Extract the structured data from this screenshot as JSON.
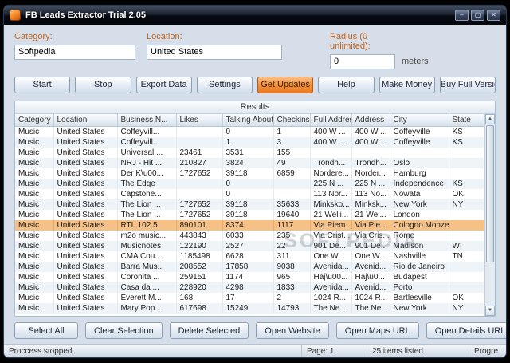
{
  "window": {
    "title": "FB Leads Extractor Trial 2.05",
    "minimize": "–",
    "maximize": "▢",
    "close": "✕"
  },
  "form": {
    "category_label": "Category:",
    "category_value": "Softpedia",
    "location_label": "Location:",
    "location_value": "United States",
    "radius_label": "Radius (0 unlimited):",
    "radius_value": "0",
    "radius_unit": "meters"
  },
  "toolbar": {
    "buttons": [
      "Start",
      "Stop",
      "Export Data",
      "Settings",
      "Get Updates",
      "Help",
      "Make Money",
      "Buy Full Version"
    ]
  },
  "results": {
    "title": "Results",
    "columns": [
      "Category",
      "Location",
      "Business N...",
      "Likes",
      "Talking About",
      "Checkins",
      "Full Address",
      "Address",
      "City",
      "State"
    ],
    "selected_index": 9,
    "rows": [
      [
        "Music",
        "United States",
        "Coffeyvill...",
        "",
        "0",
        "1",
        "400 W ...",
        "400 W ...",
        "Coffeyville",
        "KS"
      ],
      [
        "Music",
        "United States",
        "Coffeyvill...",
        "",
        "1",
        "3",
        "400 W ...",
        "400 W ...",
        "Coffeyville",
        "KS"
      ],
      [
        "Music",
        "United States",
        "Universal ...",
        "23461",
        "3531",
        "155",
        "",
        "",
        "",
        ""
      ],
      [
        "Music",
        "United States",
        "NRJ - Hit ...",
        "210827",
        "3824",
        "49",
        "Trondh...",
        "Trondh...",
        "Oslo",
        ""
      ],
      [
        "Music",
        "United States",
        "Der K\\u00...",
        "1727652",
        "39118",
        "6859",
        "Nordere...",
        "Norder...",
        "Hamburg",
        ""
      ],
      [
        "Music",
        "United States",
        "The Edge",
        "",
        "0",
        "",
        "225 N ...",
        "225 N ...",
        "Independence",
        "KS"
      ],
      [
        "Music",
        "United States",
        "Capstone...",
        "",
        "0",
        "",
        "113 Nor...",
        "113 No...",
        "Nowata",
        "OK"
      ],
      [
        "Music",
        "United States",
        "The Lion ...",
        "1727652",
        "39118",
        "35633",
        "Minksko...",
        "Minksk...",
        "New York",
        "NY"
      ],
      [
        "Music",
        "United States",
        "The Lion ...",
        "1727652",
        "39118",
        "19640",
        "21 Welli...",
        "21 Wel...",
        "London",
        ""
      ],
      [
        "Music",
        "United States",
        "RTL 102.5",
        "890101",
        "8374",
        "1117",
        "Via Piem...",
        "Via Pie...",
        "Cologno Monzese",
        ""
      ],
      [
        "Music",
        "United States",
        "m2o music...",
        "443843",
        "6033",
        "235",
        "Via Crist...",
        "Via Cris...",
        "Rome",
        ""
      ],
      [
        "Music",
        "United States",
        "Musicnotes",
        "122190",
        "2527",
        "22",
        "901 De...",
        "901 De...",
        "Madison",
        "WI"
      ],
      [
        "Music",
        "United States",
        "CMA Cou...",
        "1185498",
        "6628",
        "311",
        "One W...",
        "One W...",
        "Nashville",
        "TN"
      ],
      [
        "Music",
        "United States",
        "Barra Mus...",
        "208552",
        "17858",
        "9038",
        "Avenida...",
        "Avenid...",
        "Rio de Janeiro",
        ""
      ],
      [
        "Music",
        "United States",
        "Coronita ...",
        "259151",
        "1174",
        "965",
        "Haj\\u00...",
        "Haj\\u0...",
        "Budapest",
        ""
      ],
      [
        "Music",
        "United States",
        "Casa da ...",
        "228920",
        "4298",
        "1833",
        "Avenida...",
        "Avenid...",
        "Porto",
        ""
      ],
      [
        "Music",
        "United States",
        "Everett M...",
        "168",
        "17",
        "2",
        "1024 R...",
        "1024 R...",
        "Bartlesville",
        "OK"
      ],
      [
        "Music",
        "United States",
        "Mary Pop...",
        "617698",
        "15249",
        "14793",
        "The Ne...",
        "The Ne...",
        "New York",
        "NY"
      ]
    ]
  },
  "scrollbar": {
    "up": "▲",
    "down": "▼"
  },
  "watermark": "SOFTPEDIA",
  "actions": [
    "Select All",
    "Clear Selection",
    "Delete Selected",
    "Open Website",
    "Open Maps URL",
    "Open Details URL"
  ],
  "statusbar": {
    "status": "Proccess stopped.",
    "page": "Page: 1",
    "items": "25 items listed",
    "progress": "Progre"
  }
}
